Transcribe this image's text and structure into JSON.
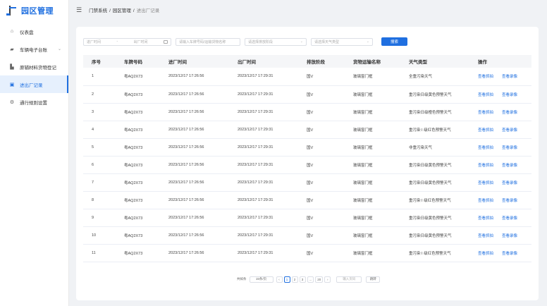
{
  "app": {
    "title": "园区管理"
  },
  "sidebar": {
    "items": [
      {
        "label": "仪表盘",
        "icon": "home-icon"
      },
      {
        "label": "车辆电子台账",
        "icon": "truck-icon",
        "has_children": true
      },
      {
        "label": "原辅材料货物登记",
        "icon": "factory-icon"
      },
      {
        "label": "进出厂记录",
        "icon": "calendar-icon",
        "active": true
      },
      {
        "label": "通行规则设置",
        "icon": "gear-icon"
      }
    ]
  },
  "breadcrumb": {
    "items": [
      "门禁系统",
      "园区管理",
      "进出厂记录"
    ]
  },
  "filters": {
    "start_placeholder": "进厂时间",
    "end_placeholder": "出厂时间",
    "plate_placeholder": "请输入车牌号码/运输货物名称",
    "stage_placeholder": "请选择排放阶段",
    "weather_placeholder": "请选择天气类型",
    "search_label": "搜索"
  },
  "table": {
    "columns": [
      "序号",
      "车牌号码",
      "进厂时间",
      "出厂时间",
      "排放阶段",
      "货物运输名称",
      "天气类型",
      "操作"
    ],
    "action_labels": [
      "查看抓拍",
      "查看录像"
    ],
    "rows": [
      {
        "no": "1",
        "plate": "粤AQ2X73",
        "in": "2023/12/17  17:26:56",
        "out": "2023/12/17  17:29:31",
        "stage": "国V",
        "goods": "玻璃窗门框",
        "weather": "全重污染天气"
      },
      {
        "no": "2",
        "plate": "粤AQ2X73",
        "in": "2023/12/17  17:26:56",
        "out": "2023/12/17  17:29:31",
        "stage": "国V",
        "goods": "玻璃窗门框",
        "weather": "重污染日级黄色预警天气"
      },
      {
        "no": "3",
        "plate": "粤AQ2X73",
        "in": "2023/12/17  17:26:56",
        "out": "2023/12/17  17:29:31",
        "stage": "国V",
        "goods": "玻璃窗门框",
        "weather": "重污染日级橙色预警天气"
      },
      {
        "no": "4",
        "plate": "粤AQ2X73",
        "in": "2023/12/17  17:26:56",
        "out": "2023/12/17  17:29:31",
        "stage": "国V",
        "goods": "玻璃窗门框",
        "weather": "重污染 I 级红色预警天气"
      },
      {
        "no": "5",
        "plate": "粤AQ2X73",
        "in": "2023/12/17  17:26:56",
        "out": "2023/12/17  17:29:31",
        "stage": "国V",
        "goods": "玻璃窗门框",
        "weather": "非重污染天气"
      },
      {
        "no": "6",
        "plate": "粤AQ2X73",
        "in": "2023/12/17  17:26:56",
        "out": "2023/12/17  17:29:31",
        "stage": "国V",
        "goods": "玻璃窗门框",
        "weather": "重污染日级黄色预警天气"
      },
      {
        "no": "7",
        "plate": "粤AQ2X73",
        "in": "2023/12/17  17:26:56",
        "out": "2023/12/17  17:29:31",
        "stage": "国V",
        "goods": "玻璃窗门框",
        "weather": "重污染日级黄色预警天气"
      },
      {
        "no": "8",
        "plate": "粤AQ2X73",
        "in": "2023/12/17  17:26:56",
        "out": "2023/12/17  17:29:31",
        "stage": "国V",
        "goods": "玻璃窗门框",
        "weather": "重污染 I 级红色预警天气"
      },
      {
        "no": "9",
        "plate": "粤AQ2X73",
        "in": "2023/12/17  17:26:56",
        "out": "2023/12/17  17:29:31",
        "stage": "国V",
        "goods": "玻璃窗门框",
        "weather": "重污染日级黄色预警天气"
      },
      {
        "no": "10",
        "plate": "粤AQ2X73",
        "in": "2023/12/17  17:26:56",
        "out": "2023/12/17  17:29:31",
        "stage": "国V",
        "goods": "玻璃窗门框",
        "weather": "重污染日级黄色预警天气"
      },
      {
        "no": "11",
        "plate": "粤AQ2X73",
        "in": "2023/12/17  17:26:56",
        "out": "2023/12/17  17:29:31",
        "stage": "国V",
        "goods": "玻璃窗门框",
        "weather": "重污染 I 级红色预警天气"
      }
    ]
  },
  "pagination": {
    "total_label": "共如条",
    "page_size": "15条/页",
    "pages": [
      "1",
      "2",
      "3",
      "...",
      "20"
    ],
    "current": "1",
    "prev": "‹",
    "next": "›",
    "jump_placeholder": "输入页码",
    "go_label": "跳转"
  },
  "colors": {
    "accent": "#1f6fe0",
    "active_bg": "#e6f0fd"
  }
}
